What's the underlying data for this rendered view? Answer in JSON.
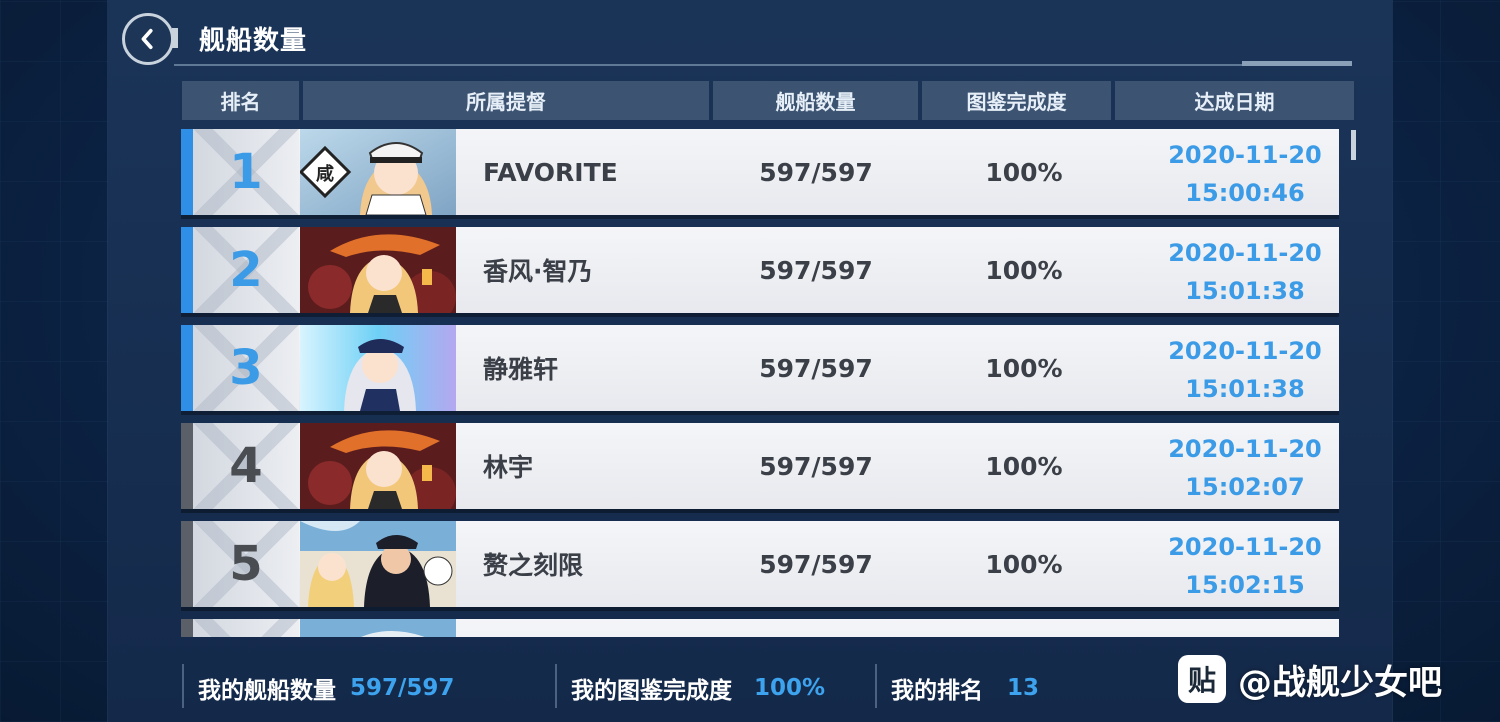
{
  "header": {
    "title": "舰船数量"
  },
  "columns": [
    "排名",
    "所属提督",
    "舰船数量",
    "图鉴完成度",
    "达成日期"
  ],
  "rows": [
    {
      "rank": "1",
      "name": "FAVORITE",
      "ships": "597/597",
      "completion": "100%",
      "date": "2020-11-20",
      "time": "15:00:46",
      "highlight": true
    },
    {
      "rank": "2",
      "name": "香风·智乃",
      "ships": "597/597",
      "completion": "100%",
      "date": "2020-11-20",
      "time": "15:01:38",
      "highlight": true
    },
    {
      "rank": "3",
      "name": "静雅轩",
      "ships": "597/597",
      "completion": "100%",
      "date": "2020-11-20",
      "time": "15:01:38",
      "highlight": true
    },
    {
      "rank": "4",
      "name": "林宇",
      "ships": "597/597",
      "completion": "100%",
      "date": "2020-11-20",
      "time": "15:02:07",
      "highlight": false
    },
    {
      "rank": "5",
      "name": "赘之刻限",
      "ships": "597/597",
      "completion": "100%",
      "date": "2020-11-20",
      "time": "15:02:15",
      "highlight": false
    }
  ],
  "footer": {
    "my_ships_label": "我的舰船数量",
    "my_ships_value": "597/597",
    "my_completion_label": "我的图鉴完成度",
    "my_completion_value": "100%",
    "my_rank_label": "我的排名",
    "my_rank_value": "13"
  },
  "watermark": {
    "icon_text": "贴",
    "text": "@战舰少女吧"
  },
  "colors": {
    "top_rank": "#3b9be6",
    "other_rank": "#4a4d52",
    "date": "#3b9be6",
    "stripe_top": "#2f8fe6",
    "stripe_other": "#5b6068"
  },
  "icons": {
    "back": "chevron-left-icon"
  }
}
